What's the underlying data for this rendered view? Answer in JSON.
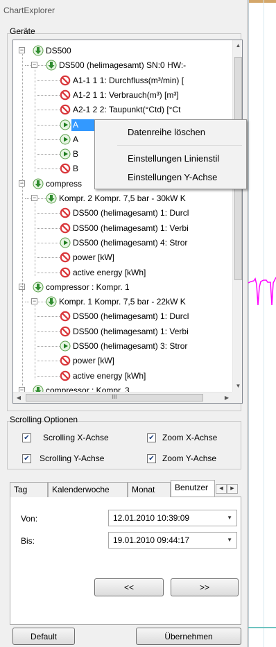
{
  "window": {
    "title": "ChartExplorer"
  },
  "devices": {
    "label": "Geräte",
    "tree": [
      {
        "depth": 0,
        "expander": "−",
        "icon": "down-arrow-icon",
        "label": "DS500"
      },
      {
        "depth": 1,
        "expander": "−",
        "icon": "down-arrow-icon",
        "label": "DS500 (helimagesamt)  SN:0  HW:-"
      },
      {
        "depth": 2,
        "expander": "",
        "icon": "blocked-icon",
        "label": "A1-1 1 1: Durchfluss(m³/min) ["
      },
      {
        "depth": 2,
        "expander": "",
        "icon": "blocked-icon",
        "label": "A1-2 1 1: Verbrauch(m³) [m³]"
      },
      {
        "depth": 2,
        "expander": "",
        "icon": "blocked-icon",
        "label": "A2-1 2 2: Taupunkt(°Ctd) [°Ct"
      },
      {
        "depth": 2,
        "expander": "",
        "icon": "play-icon",
        "label": "A",
        "selected": true
      },
      {
        "depth": 2,
        "expander": "",
        "icon": "play-icon",
        "label": "A"
      },
      {
        "depth": 2,
        "expander": "",
        "icon": "play-icon",
        "label": "B"
      },
      {
        "depth": 2,
        "expander": "",
        "icon": "blocked-icon",
        "label": "B"
      },
      {
        "depth": 0,
        "expander": "−",
        "icon": "down-arrow-icon",
        "label": "compress"
      },
      {
        "depth": 1,
        "expander": "−",
        "icon": "down-arrow-icon",
        "label": "Kompr. 2 Kompr. 7,5 bar - 30kW K"
      },
      {
        "depth": 2,
        "expander": "",
        "icon": "blocked-icon",
        "label": "DS500 (helimagesamt) 1: Durcl"
      },
      {
        "depth": 2,
        "expander": "",
        "icon": "blocked-icon",
        "label": "DS500 (helimagesamt) 1: Verbi"
      },
      {
        "depth": 2,
        "expander": "",
        "icon": "play-icon",
        "label": "DS500 (helimagesamt) 4: Stror"
      },
      {
        "depth": 2,
        "expander": "",
        "icon": "blocked-icon",
        "label": "power  [kW]"
      },
      {
        "depth": 2,
        "expander": "",
        "icon": "blocked-icon",
        "label": "active energy  [kWh]"
      },
      {
        "depth": 0,
        "expander": "−",
        "icon": "down-arrow-icon",
        "label": "compressor : Kompr. 1"
      },
      {
        "depth": 1,
        "expander": "−",
        "icon": "down-arrow-icon",
        "label": "Kompr. 1 Kompr. 7,5 bar - 22kW K"
      },
      {
        "depth": 2,
        "expander": "",
        "icon": "blocked-icon",
        "label": "DS500 (helimagesamt) 1: Durcl"
      },
      {
        "depth": 2,
        "expander": "",
        "icon": "blocked-icon",
        "label": "DS500 (helimagesamt) 1: Verbi"
      },
      {
        "depth": 2,
        "expander": "",
        "icon": "play-icon",
        "label": "DS500 (helimagesamt) 3: Stror"
      },
      {
        "depth": 2,
        "expander": "",
        "icon": "blocked-icon",
        "label": "power  [kW]"
      },
      {
        "depth": 2,
        "expander": "",
        "icon": "blocked-icon",
        "label": "active energy  [kWh]"
      },
      {
        "depth": 0,
        "expander": "−",
        "icon": "down-arrow-icon",
        "label": "compressor : Kompr. 3"
      }
    ]
  },
  "context_menu": {
    "items": [
      "Datenreihe löschen",
      "Einstellungen Linienstil",
      "Einstellungen Y-Achse"
    ]
  },
  "scrolling_options": {
    "label": "Scrolling Optionen",
    "scroll_x": {
      "label": "Scrolling X-Achse",
      "checked": true
    },
    "zoom_x": {
      "label": "Zoom X-Achse",
      "checked": true
    },
    "scroll_y": {
      "label": "Scrolling Y-Achse",
      "checked": true
    },
    "zoom_y": {
      "label": "Zoom Y-Achse",
      "checked": true
    }
  },
  "tabs": [
    "Tag",
    "Kalenderwoche",
    "Monat",
    "Benutzer"
  ],
  "active_tab": "Benutzer",
  "range": {
    "von_label": "Von:",
    "von_value": "12.01.2010 10:39:09",
    "bis_label": "Bis:",
    "bis_value": "19.01.2010 09:44:17",
    "prev_label": "<<",
    "next_label": ">>"
  },
  "buttons": {
    "default_label": "Default",
    "apply_label": "Übernehmen"
  },
  "colors": {
    "selection": "#3399ff",
    "chart_line": "#ff00ff",
    "teal_line": "#6fc4c0"
  }
}
